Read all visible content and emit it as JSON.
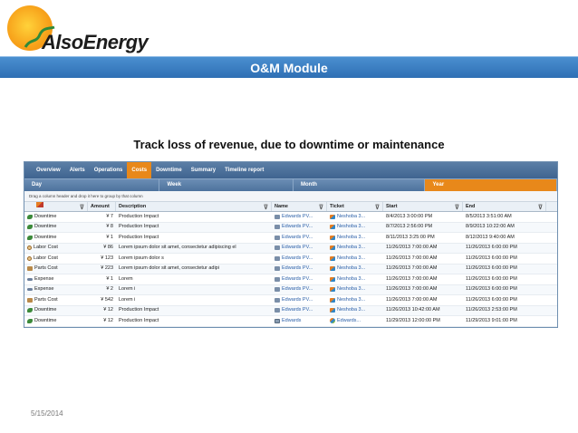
{
  "logo": {
    "text": "AlsoEnergy"
  },
  "banner": {
    "title": "O&M Module"
  },
  "headline": "Track loss of revenue, due to downtime or maintenance",
  "tabs": [
    {
      "label": "Overview"
    },
    {
      "label": "Alerts"
    },
    {
      "label": "Operations"
    },
    {
      "label": "Costs",
      "active": true
    },
    {
      "label": "Downtime"
    },
    {
      "label": "Summary"
    },
    {
      "label": "Timeline report"
    }
  ],
  "periods": [
    {
      "label": "Day"
    },
    {
      "label": "Week"
    },
    {
      "label": "Month"
    },
    {
      "label": "Year",
      "active": true
    }
  ],
  "group_hint": "Drag a column header and drop it here to group by that column",
  "columns": {
    "amount": "Amount",
    "description": "Description",
    "name": "Name",
    "ticket": "Ticket",
    "start": "Start",
    "end": "End"
  },
  "rows": [
    {
      "category": "Downtime",
      "icon": "downtime-icon",
      "amount": "¥ 7",
      "description": "Production Impact",
      "name": "Edwards PV...",
      "ticket": "Neshoba 3...",
      "start": "8/4/2013 3:00:00 PM",
      "end": "8/5/2013 3:51:00 AM"
    },
    {
      "category": "Downtime",
      "icon": "downtime-icon",
      "amount": "¥ 8",
      "description": "Production Impact",
      "name": "Edwards PV...",
      "ticket": "Neshoba 3...",
      "start": "8/7/2013 2:56:00 PM",
      "end": "8/9/2013 10:22:00 AM"
    },
    {
      "category": "Downtime",
      "icon": "downtime-icon",
      "amount": "¥ 1",
      "description": "Production Impact",
      "name": "Edwards PV...",
      "ticket": "Neshoba 3...",
      "start": "8/11/2013 3:25:00 PM",
      "end": "8/12/2013 9:40:00 AM"
    },
    {
      "category": "Labor Cost",
      "icon": "labor-icon",
      "amount": "¥ 86",
      "description": "Lorem ipsum dolor sit amet, consectetur adipiscing el",
      "name": "Edwards PV...",
      "ticket": "Neshoba 3...",
      "start": "11/26/2013 7:00:00 AM",
      "end": "11/26/2013 6:00:00 PM"
    },
    {
      "category": "Labor Cost",
      "icon": "labor-icon",
      "amount": "¥ 123",
      "description": "Lorem ipsum dolor s",
      "name": "Edwards PV...",
      "ticket": "Neshoba 3...",
      "start": "11/26/2013 7:00:00 AM",
      "end": "11/26/2013 6:00:00 PM"
    },
    {
      "category": "Parts Cost",
      "icon": "parts-icon",
      "amount": "¥ 223",
      "description": "Lorem ipsum dolor sit amet, consectetur adipi",
      "name": "Edwards PV...",
      "ticket": "Neshoba 3...",
      "start": "11/26/2013 7:00:00 AM",
      "end": "11/26/2013 6:00:00 PM"
    },
    {
      "category": "Expense",
      "icon": "expense-icon",
      "amount": "¥ 1",
      "description": "Lorem",
      "name": "Edwards PV...",
      "ticket": "Neshoba 3...",
      "start": "11/26/2013 7:00:00 AM",
      "end": "11/26/2013 6:00:00 PM"
    },
    {
      "category": "Expense",
      "icon": "expense-icon",
      "amount": "¥ 2",
      "description": "Lorem i",
      "name": "Edwards PV...",
      "ticket": "Neshoba 3...",
      "start": "11/26/2013 7:00:00 AM",
      "end": "11/26/2013 6:00:00 PM"
    },
    {
      "category": "Parts Cost",
      "icon": "parts-icon",
      "amount": "¥ 542",
      "description": "Lorem i",
      "name": "Edwards PV...",
      "ticket": "Neshoba 3...",
      "start": "11/26/2013 7:00:00 AM",
      "end": "11/26/2013 6:00:00 PM"
    },
    {
      "category": "Downtime",
      "icon": "downtime-icon",
      "amount": "¥ 12",
      "description": "Production Impact",
      "name": "Edwards PV...",
      "ticket": "Neshoba 3...",
      "start": "11/26/2013 10:42:00 AM",
      "end": "11/26/2013 2:53:00 PM"
    },
    {
      "category": "Downtime",
      "icon": "downtime-icon",
      "amount": "¥ 12",
      "description": "Production Impact",
      "name": "Edwards",
      "ticket": "Edwards...",
      "start": "11/29/2013 12:00:00 PM",
      "end": "11/29/2013 9:01:00 PM"
    }
  ],
  "footer": {
    "date": "5/15/2014"
  }
}
